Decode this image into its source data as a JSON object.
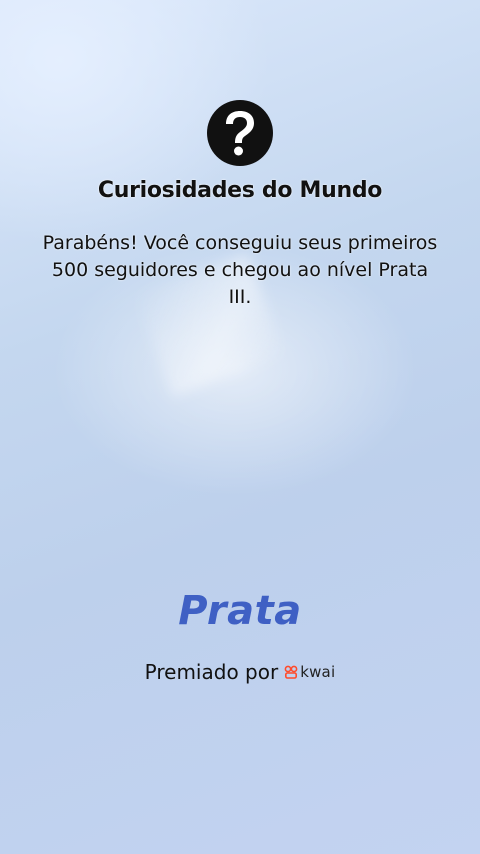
{
  "icon": {
    "name": "question-mark-icon"
  },
  "title": "Curiosidades do Mundo",
  "message": "Parabéns! Você conseguiu seus primeiros 500 seguidores e chegou ao nível Prata III.",
  "tier": "Prata",
  "awarded_by": {
    "label": "Premiado por",
    "brand": "kwai",
    "brand_icon": "kwai-logo-icon",
    "brand_color": "#ff4b2b"
  },
  "colors": {
    "tier_text": "#3f60c4",
    "text": "#111111"
  }
}
